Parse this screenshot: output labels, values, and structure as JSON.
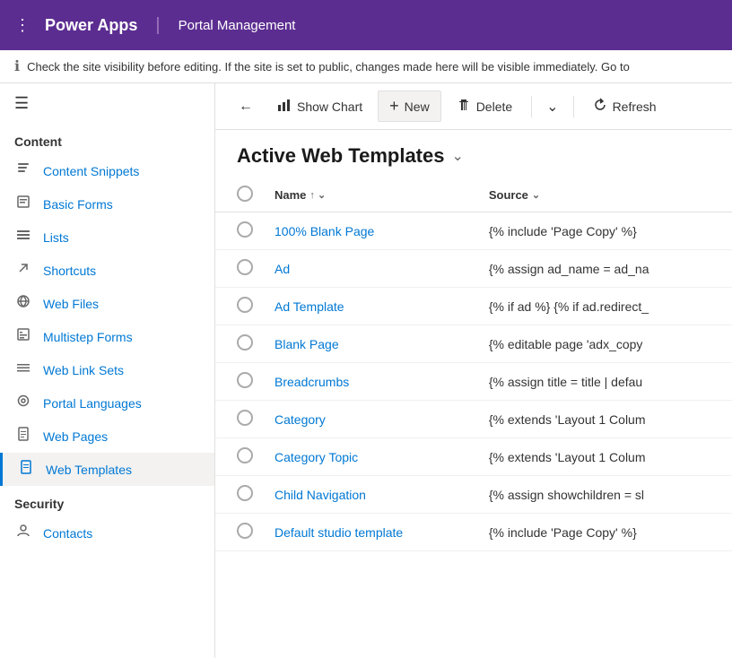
{
  "topNav": {
    "gridIcon": "⠿",
    "appTitle": "Power Apps",
    "divider": "|",
    "moduleTitle": "Portal Management"
  },
  "infoBanner": {
    "text": "Check the site visibility before editing. If the site is set to public, changes made here will be visible immediately. Go to"
  },
  "sidebar": {
    "hamburgerIcon": "☰",
    "sectionContent": "Content",
    "items": [
      {
        "id": "content-snippets",
        "label": "Content Snippets",
        "icon": "📄"
      },
      {
        "id": "basic-forms",
        "label": "Basic Forms",
        "icon": "📋"
      },
      {
        "id": "lists",
        "label": "Lists",
        "icon": "📃"
      },
      {
        "id": "shortcuts",
        "label": "Shortcuts",
        "icon": "↗"
      },
      {
        "id": "web-files",
        "label": "Web Files",
        "icon": "🌐"
      },
      {
        "id": "multistep-forms",
        "label": "Multistep Forms",
        "icon": "📄"
      },
      {
        "id": "web-link-sets",
        "label": "Web Link Sets",
        "icon": "☰"
      },
      {
        "id": "portal-languages",
        "label": "Portal Languages",
        "icon": "🌐"
      },
      {
        "id": "web-pages",
        "label": "Web Pages",
        "icon": "📄"
      },
      {
        "id": "web-templates",
        "label": "Web Templates",
        "icon": "📄",
        "active": true
      }
    ],
    "sectionSecurity": "Security",
    "securityItems": [
      {
        "id": "contacts",
        "label": "Contacts",
        "icon": "👤"
      }
    ]
  },
  "toolbar": {
    "backIcon": "←",
    "showChartIcon": "📊",
    "showChartLabel": "Show Chart",
    "newIcon": "+",
    "newLabel": "New",
    "deleteIcon": "🗑",
    "deleteLabel": "Delete",
    "chevronIcon": "⌄",
    "refreshIcon": "↻",
    "refreshLabel": "Refresh"
  },
  "tableTitle": "Active Web Templates",
  "tableTitleChevron": "⌄",
  "tableColumns": [
    {
      "id": "name",
      "label": "Name",
      "sortIcon": "↑ ⌄"
    },
    {
      "id": "source",
      "label": "Source",
      "sortIcon": "⌄"
    }
  ],
  "tableRows": [
    {
      "name": "100% Blank Page",
      "source": "{% include 'Page Copy' %}"
    },
    {
      "name": "Ad",
      "source": "{% assign ad_name = ad_na"
    },
    {
      "name": "Ad Template",
      "source": "{% if ad %} {% if ad.redirect_"
    },
    {
      "name": "Blank Page",
      "source": "{% editable page 'adx_copy"
    },
    {
      "name": "Breadcrumbs",
      "source": "{% assign title = title | defau"
    },
    {
      "name": "Category",
      "source": "{% extends 'Layout 1 Colum"
    },
    {
      "name": "Category Topic",
      "source": "{% extends 'Layout 1 Colum"
    },
    {
      "name": "Child Navigation",
      "source": "{% assign showchildren = sl"
    },
    {
      "name": "Default studio template",
      "source": "{% include 'Page Copy' %}"
    }
  ]
}
